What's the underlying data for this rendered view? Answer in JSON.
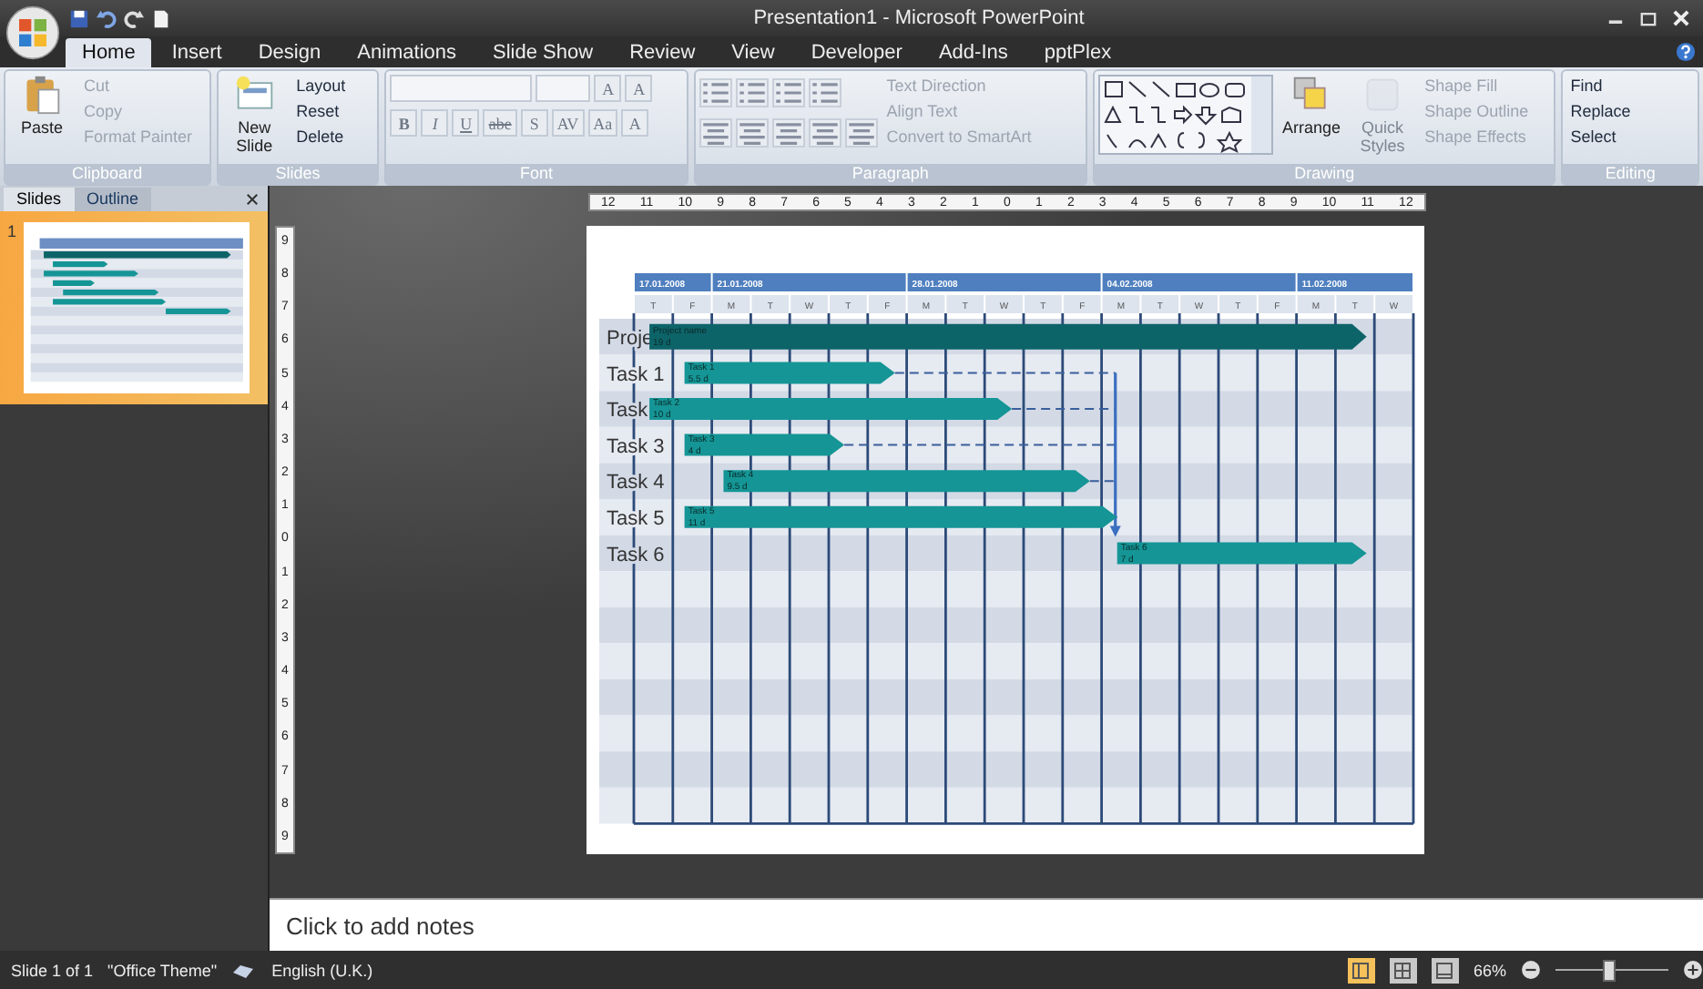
{
  "window": {
    "title": "Presentation1 - Microsoft PowerPoint"
  },
  "tabs": [
    {
      "label": "Home",
      "selected": true
    },
    {
      "label": "Insert",
      "selected": false
    },
    {
      "label": "Design",
      "selected": false
    },
    {
      "label": "Animations",
      "selected": false
    },
    {
      "label": "Slide Show",
      "selected": false
    },
    {
      "label": "Review",
      "selected": false
    },
    {
      "label": "View",
      "selected": false
    },
    {
      "label": "Developer",
      "selected": false
    },
    {
      "label": "Add-Ins",
      "selected": false
    },
    {
      "label": "pptPlex",
      "selected": false
    }
  ],
  "ribbon": [
    {
      "kind": "clipboard",
      "label": "Clipboard",
      "big": [
        {
          "label": "Paste"
        }
      ],
      "items": [
        {
          "label": "Cut",
          "disabled": true
        },
        {
          "label": "Copy",
          "disabled": true
        },
        {
          "label": "Format Painter",
          "disabled": true
        }
      ]
    },
    {
      "kind": "slides",
      "label": "Slides",
      "big": [
        {
          "label": "New Slide"
        }
      ],
      "items": [
        {
          "label": "Layout",
          "disabled": false
        },
        {
          "label": "Reset",
          "disabled": false
        },
        {
          "label": "Delete",
          "disabled": false
        }
      ]
    },
    {
      "kind": "font",
      "label": "Font",
      "size_buttons": [
        "A",
        "A"
      ],
      "buttons": [
        "B",
        "I",
        "U",
        "abe",
        "S",
        "AV",
        "Aa",
        "A"
      ]
    },
    {
      "kind": "paragraph",
      "label": "Paragraph",
      "items": [
        {
          "label": "Text Direction",
          "disabled": true
        },
        {
          "label": "Align Text",
          "disabled": true
        },
        {
          "label": "Convert to SmartArt",
          "disabled": true
        }
      ]
    },
    {
      "kind": "drawing",
      "label": "Drawing",
      "big": [
        {
          "label": "Arrange",
          "disabled": false
        },
        {
          "label": "Quick Styles",
          "disabled": true
        }
      ],
      "items": [
        {
          "label": "Shape Fill",
          "disabled": true
        },
        {
          "label": "Shape Outline",
          "disabled": true
        },
        {
          "label": "Shape Effects",
          "disabled": true
        }
      ]
    },
    {
      "kind": "editing",
      "label": "Editing",
      "items": [
        {
          "label": "Find",
          "disabled": false
        },
        {
          "label": "Replace",
          "disabled": false
        },
        {
          "label": "Select",
          "disabled": false
        }
      ]
    }
  ],
  "panel_tabs": [
    {
      "label": "Slides",
      "selected": true
    },
    {
      "label": "Outline",
      "selected": false
    }
  ],
  "thumbnails": [
    {
      "number": "1",
      "selected": true
    }
  ],
  "ruler": {
    "horizontal": [
      "12",
      "11",
      "10",
      "9",
      "8",
      "7",
      "6",
      "5",
      "4",
      "3",
      "2",
      "1",
      "0",
      "1",
      "2",
      "3",
      "4",
      "5",
      "6",
      "7",
      "8",
      "9",
      "10",
      "11",
      "12"
    ],
    "vertical": [
      "9",
      "8",
      "7",
      "6",
      "5",
      "4",
      "3",
      "2",
      "1",
      "0",
      "1",
      "2",
      "3",
      "4",
      "5",
      "6",
      "7",
      "8",
      "9"
    ]
  },
  "gantt": {
    "weeks": [
      "17.01.2008",
      "21.01.2008",
      "28.01.2008",
      "04.02.2008",
      "11.02.2008"
    ],
    "days": [
      "T",
      "F",
      "M",
      "T",
      "W",
      "T",
      "F",
      "M",
      "T",
      "W",
      "T",
      "F",
      "M",
      "T",
      "W",
      "T",
      "F",
      "M",
      "T",
      "W"
    ],
    "rows": [
      {
        "label": "Proje",
        "bar": {
          "kind": "summary",
          "name": "Project name",
          "duration": "19 d"
        }
      },
      {
        "label": "Task 1",
        "bar": {
          "kind": "task",
          "name": "Task 1",
          "duration": "5.5 d"
        }
      },
      {
        "label": "Task",
        "bar": {
          "kind": "task",
          "name": "Task 2",
          "duration": "10 d"
        }
      },
      {
        "label": "Task 3",
        "bar": {
          "kind": "task",
          "name": "Task 3",
          "duration": "4 d"
        }
      },
      {
        "label": "Task 4",
        "bar": {
          "kind": "task",
          "name": "Task 4",
          "duration": "9.5 d"
        }
      },
      {
        "label": "Task 5",
        "bar": {
          "kind": "task",
          "name": "Task 5",
          "duration": "11 d"
        }
      },
      {
        "label": "Task 6",
        "bar": {
          "kind": "task",
          "name": "Task 6",
          "duration": "7 d"
        }
      }
    ]
  },
  "notes": {
    "placeholder": "Click to add notes"
  },
  "status_bar": {
    "items": [
      "Slide 1 of 1",
      "\"Office Theme\"",
      "English (U.K.)"
    ],
    "views": [
      {
        "selected": true
      },
      {
        "selected": false
      },
      {
        "selected": false
      }
    ],
    "zoom": "66%",
    "zoom_slider": {
      "level": 0.46
    }
  }
}
